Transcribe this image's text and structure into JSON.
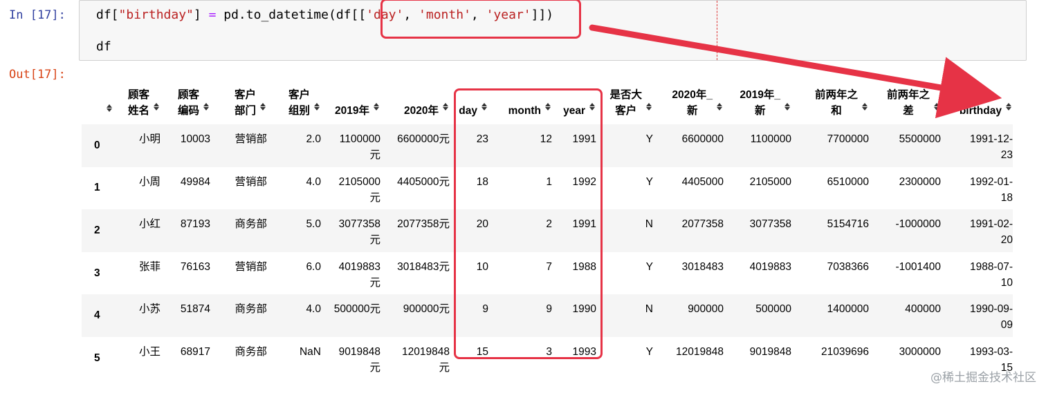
{
  "in_prompt": "In [17]:",
  "out_prompt": "Out[17]:",
  "code": {
    "line1_var": "df[",
    "line1_key": "\"birthday\"",
    "line1_mid": "] ",
    "line1_eq": "=",
    "line1_call": " pd.to_datetime(df[[",
    "line1_s1": "'day'",
    "line1_c1": ", ",
    "line1_s2": "'month'",
    "line1_c2": ", ",
    "line1_s3": "'year'",
    "line1_end": "]])",
    "line2": "df"
  },
  "columns": [
    {
      "line1": "",
      "line2": ""
    },
    {
      "line1": "顾客",
      "line2": "姓名"
    },
    {
      "line1": "顾客",
      "line2": "编码"
    },
    {
      "line1": "客户",
      "line2": "部门"
    },
    {
      "line1": "客户",
      "line2": "组别"
    },
    {
      "line1": "",
      "line2": "2019年"
    },
    {
      "line1": "",
      "line2": "2020年"
    },
    {
      "line1": "",
      "line2": "day"
    },
    {
      "line1": "",
      "line2": "month"
    },
    {
      "line1": "",
      "line2": "year"
    },
    {
      "line1": "是否大",
      "line2": "客户"
    },
    {
      "line1": "2020年_",
      "line2": "新"
    },
    {
      "line1": "2019年_",
      "line2": "新"
    },
    {
      "line1": "前两年之",
      "line2": "和"
    },
    {
      "line1": "前两年之",
      "line2": "差"
    },
    {
      "line1": "",
      "line2": "birthday"
    }
  ],
  "rows": [
    {
      "idx": "0",
      "name": "小明",
      "code": "10003",
      "dept": "营销部",
      "group": "2.0",
      "y2019": [
        "1100000",
        "元"
      ],
      "y2020": [
        "6600000元",
        ""
      ],
      "day": "23",
      "month": "12",
      "year": "1991",
      "vip": "Y",
      "n2020": "6600000",
      "n2019": "1100000",
      "sum": "7700000",
      "diff": "5500000",
      "birthday": [
        "1991-12-",
        "23"
      ]
    },
    {
      "idx": "1",
      "name": "小周",
      "code": "49984",
      "dept": "营销部",
      "group": "4.0",
      "y2019": [
        "2105000",
        "元"
      ],
      "y2020": [
        "4405000元",
        ""
      ],
      "day": "18",
      "month": "1",
      "year": "1992",
      "vip": "Y",
      "n2020": "4405000",
      "n2019": "2105000",
      "sum": "6510000",
      "diff": "2300000",
      "birthday": [
        "1992-01-",
        "18"
      ]
    },
    {
      "idx": "2",
      "name": "小红",
      "code": "87193",
      "dept": "商务部",
      "group": "5.0",
      "y2019": [
        "3077358",
        "元"
      ],
      "y2020": [
        "2077358元",
        ""
      ],
      "day": "20",
      "month": "2",
      "year": "1991",
      "vip": "N",
      "n2020": "2077358",
      "n2019": "3077358",
      "sum": "5154716",
      "diff": "-1000000",
      "birthday": [
        "1991-02-",
        "20"
      ]
    },
    {
      "idx": "3",
      "name": "张菲",
      "code": "76163",
      "dept": "营销部",
      "group": "6.0",
      "y2019": [
        "4019883",
        "元"
      ],
      "y2020": [
        "3018483元",
        ""
      ],
      "day": "10",
      "month": "7",
      "year": "1988",
      "vip": "Y",
      "n2020": "3018483",
      "n2019": "4019883",
      "sum": "7038366",
      "diff": "-1001400",
      "birthday": [
        "1988-07-",
        "10"
      ]
    },
    {
      "idx": "4",
      "name": "小苏",
      "code": "51874",
      "dept": "商务部",
      "group": "4.0",
      "y2019": [
        "500000元",
        ""
      ],
      "y2020": [
        "900000元",
        ""
      ],
      "day": "9",
      "month": "9",
      "year": "1990",
      "vip": "N",
      "n2020": "900000",
      "n2019": "500000",
      "sum": "1400000",
      "diff": "400000",
      "birthday": [
        "1990-09-",
        "09"
      ]
    },
    {
      "idx": "5",
      "name": "小王",
      "code": "68917",
      "dept": "商务部",
      "group": "NaN",
      "y2019": [
        "9019848",
        "元"
      ],
      "y2020": [
        "12019848",
        "元"
      ],
      "day": "15",
      "month": "3",
      "year": "1993",
      "vip": "Y",
      "n2020": "12019848",
      "n2019": "9019848",
      "sum": "21039696",
      "diff": "3000000",
      "birthday": [
        "1993-03-",
        "15"
      ]
    }
  ],
  "watermark": "@稀土掘金技术社区",
  "colors": {
    "highlight": "#e63346",
    "string": "#ba2121",
    "operator": "#aa22ff",
    "in_prompt": "#303f9f",
    "out_prompt": "#d84315"
  }
}
